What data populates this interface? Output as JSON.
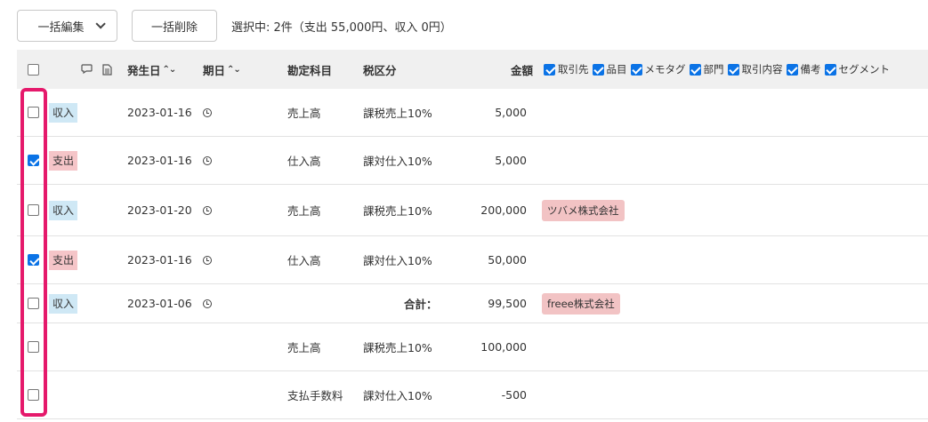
{
  "toolbar": {
    "bulk_edit_label": "一括編集",
    "bulk_delete_label": "一括削除",
    "selection_summary": "選択中: 2件（支出 55,000円、収入 0円）"
  },
  "columns": {
    "issue_date": "発生日",
    "due_date": "期日",
    "sort_icon": "⌃⌄",
    "account": "勘定科目",
    "tax": "税区分",
    "amount": "金額"
  },
  "column_toggles": [
    "取引先",
    "品目",
    "メモタグ",
    "部門",
    "取引内容",
    "備考",
    "セグメント"
  ],
  "rows": [
    {
      "checked": false,
      "type": "収入",
      "type_kind": "income",
      "date": "2023-01-16",
      "due": true,
      "account": "売上高",
      "tax": "課税売上10%",
      "amount": "5,000",
      "tag": ""
    },
    {
      "checked": true,
      "type": "支出",
      "type_kind": "expense",
      "date": "2023-01-16",
      "due": true,
      "account": "仕入高",
      "tax": "課対仕入10%",
      "amount": "5,000",
      "tag": ""
    },
    {
      "checked": false,
      "type": "収入",
      "type_kind": "income",
      "date": "2023-01-20",
      "due": true,
      "account": "売上高",
      "tax": "課税売上10%",
      "amount": "200,000",
      "tag": "ツバメ株式会社"
    },
    {
      "checked": true,
      "type": "支出",
      "type_kind": "expense",
      "date": "2023-01-16",
      "due": true,
      "account": "仕入高",
      "tax": "課対仕入10%",
      "amount": "50,000",
      "tag": ""
    },
    {
      "checked": false,
      "type": "収入",
      "type_kind": "income",
      "date": "2023-01-06",
      "due": true,
      "account": "",
      "tax": "",
      "total_label": "合計：",
      "amount": "99,500",
      "tag": "freee株式会社"
    },
    {
      "checked": false,
      "type": "",
      "type_kind": "",
      "date": "",
      "due": false,
      "account": "売上高",
      "tax": "課税売上10%",
      "amount": "100,000",
      "tag": ""
    },
    {
      "checked": false,
      "type": "",
      "type_kind": "",
      "date": "",
      "due": false,
      "account": "支払手数料",
      "tax": "課対仕入10%",
      "amount": "-500",
      "tag": ""
    }
  ],
  "colors": {
    "highlight": "#e5196b",
    "checkbox_checked": "#0b73e6",
    "income_badge": "#cfe8f5",
    "expense_badge": "#f5c5c8",
    "header_bg": "#f0f0f0"
  }
}
